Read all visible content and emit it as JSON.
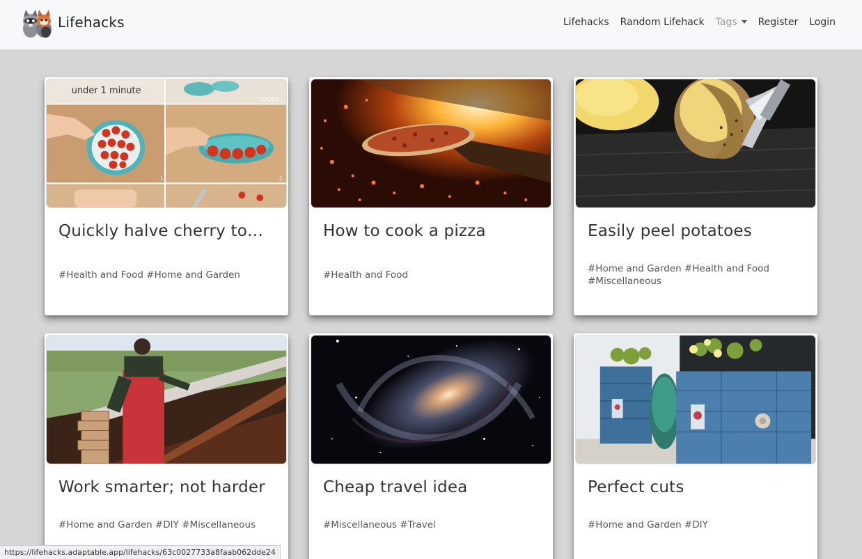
{
  "brand": {
    "name": "Lifehacks"
  },
  "nav": {
    "lifehacks": "Lifehacks",
    "random": "Random Lifehack",
    "tags": "Tags",
    "register": "Register",
    "login": "Login"
  },
  "cards": [
    {
      "title": "Quickly halve cherry toma...",
      "tags": "#Health and Food #Home and Garden",
      "image_caption": "under 1 minute",
      "image_label": "TOOLS",
      "image_num1": "1",
      "image_num2": "2"
    },
    {
      "title": "How to cook a pizza",
      "tags": "#Health and Food"
    },
    {
      "title": "Easily peel potatoes",
      "tags": "#Home and Garden #Health and Food #Miscellaneous"
    },
    {
      "title": "Work smarter; not harder",
      "tags": "#Home and Garden #DIY #Miscellaneous"
    },
    {
      "title": "Cheap travel idea",
      "tags": "#Miscellaneous #Travel"
    },
    {
      "title": "Perfect cuts",
      "tags": "#Home and Garden #DIY"
    }
  ],
  "status_bar": {
    "url": "https://lifehacks.adaptable.app/lifehacks/63c0027733a8faab062dde24"
  },
  "colors": {
    "page_bg": "#d6d6d6",
    "navbar_bg": "#f7f8f9",
    "card_bg": "#ffffff"
  }
}
